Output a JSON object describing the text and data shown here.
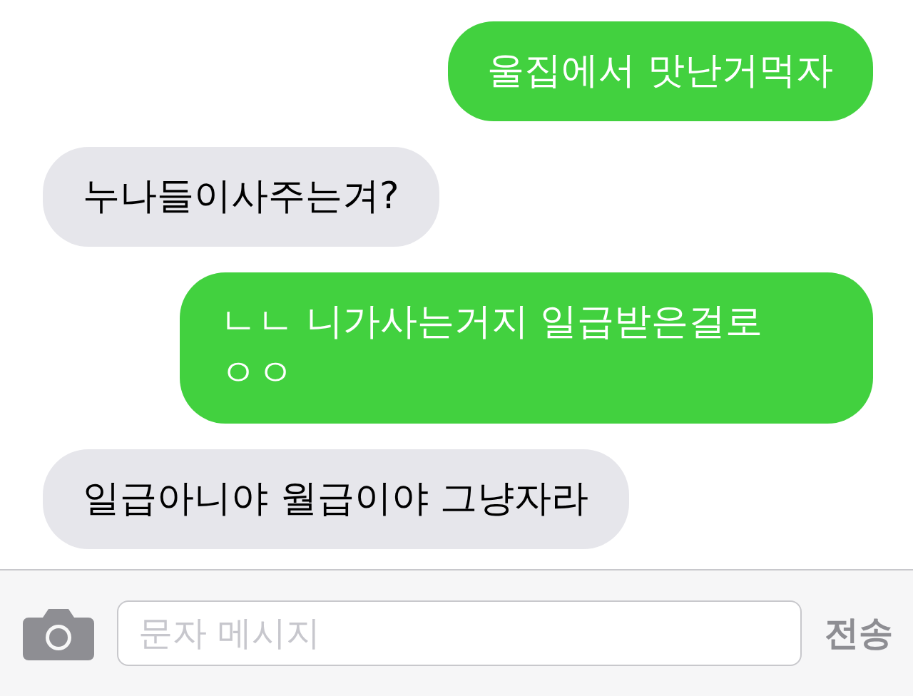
{
  "messages": [
    {
      "kind": "sent",
      "text": "울집에서 맛난거먹자"
    },
    {
      "kind": "received",
      "text": "누나들이사주는겨?"
    },
    {
      "kind": "sent",
      "text": "ㄴㄴ 니가사는거지 일급받은걸로 ㅇㅇ"
    },
    {
      "kind": "received",
      "text": "일급아니야 월급이야 그냥자라"
    }
  ],
  "input": {
    "placeholder": "문자 메시지"
  },
  "send_button": "전송"
}
